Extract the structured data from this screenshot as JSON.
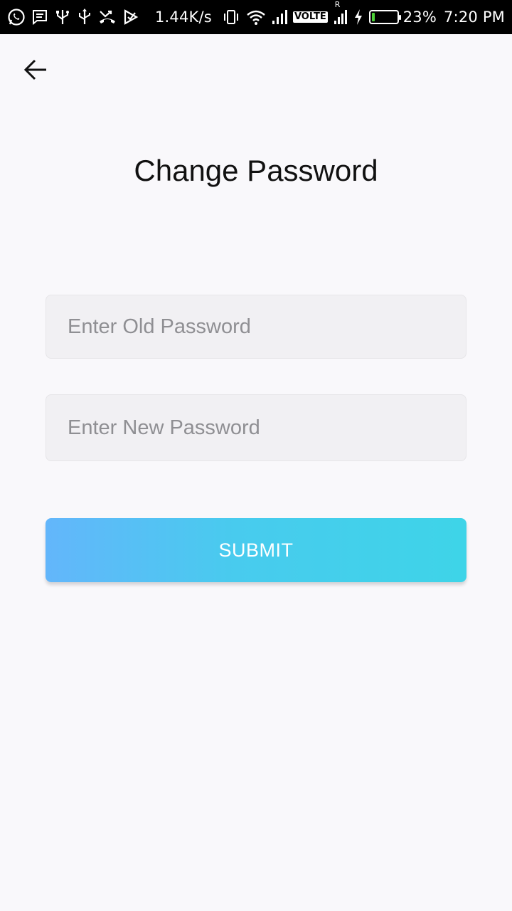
{
  "status_bar": {
    "network_speed": "1.44K/s",
    "volte_label": "VOLTE",
    "battery_percent": "23%",
    "battery_level": 0.23,
    "time": "7:20 PM",
    "roaming_label": "R"
  },
  "header": {
    "back_icon": "arrow-left-icon",
    "title": "Change Password"
  },
  "form": {
    "old_password": {
      "placeholder": "Enter Old Password",
      "value": ""
    },
    "new_password": {
      "placeholder": "Enter New Password",
      "value": ""
    },
    "submit_label": "SUBMIT"
  },
  "colors": {
    "background": "#f9f8fb",
    "button_gradient_start": "#63b6fb",
    "button_gradient_end": "#3ed4e8",
    "field_background": "#f1f0f3",
    "battery_green": "#4cd137"
  }
}
